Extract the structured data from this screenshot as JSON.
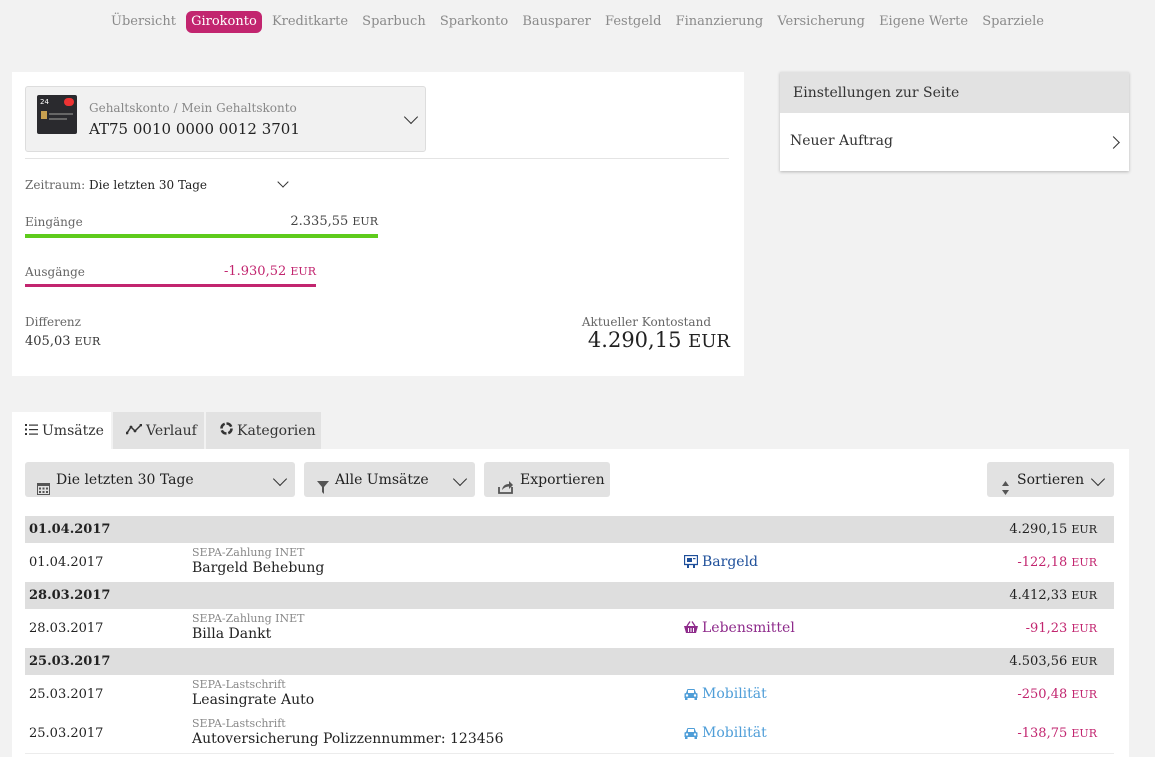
{
  "colors": {
    "accent": "#c2256f",
    "income": "#5ecb1c",
    "expense": "#c2256f",
    "cash": "#1e4f9a",
    "groceries": "#8e2b8b",
    "mobility": "#4f9ed8"
  },
  "nav": {
    "items": [
      "Übersicht",
      "Girokonto",
      "Kreditkarte",
      "Sparbuch",
      "Sparkonto",
      "Bausparer",
      "Festgeld",
      "Finanzierung",
      "Versicherung",
      "Eigene Werte",
      "Sparziele"
    ],
    "active_index": 1
  },
  "account": {
    "name": "Gehaltskonto / Mein Gehaltskonto",
    "iban": "AT75 0010 0000 0012 3701",
    "card_brand": "24"
  },
  "period": {
    "label": "Zeitraum:",
    "value": "Die letzten 30 Tage"
  },
  "summary": {
    "income_label": "Eingänge",
    "income_value": "2.335,55",
    "expense_label": "Ausgänge",
    "expense_value": "-1.930,52",
    "currency": "EUR",
    "difference_label": "Differenz",
    "difference_value": "405,03",
    "balance_label": "Aktueller Kontostand",
    "balance_value": "4.290,15"
  },
  "settings": {
    "title": "Einstellungen zur Seite",
    "new_order": "Neuer Auftrag"
  },
  "tabs": {
    "transactions": "Umsätze",
    "history": "Verlauf",
    "categories": "Kategorien"
  },
  "toolbar": {
    "period": "Die letzten 30 Tage",
    "filter": "Alle Umsätze",
    "export": "Exportieren",
    "sort": "Sortieren"
  },
  "groups": [
    {
      "date": "01.04.2017",
      "balance": "4.290,15"
    },
    {
      "date": "28.03.2017",
      "balance": "4.412,33"
    },
    {
      "date": "25.03.2017",
      "balance": "4.503,56"
    }
  ],
  "transactions": [
    {
      "date": "01.04.2017",
      "type": "SEPA-Zahlung INET",
      "description": "Bargeld Behebung",
      "category": "Bargeld",
      "category_icon": "cash-icon",
      "amount": "-122,18"
    },
    {
      "date": "28.03.2017",
      "type": "SEPA-Zahlung INET",
      "description": "Billa Dankt",
      "category": "Lebensmittel",
      "category_icon": "basket-icon",
      "amount": "-91,23"
    },
    {
      "date": "25.03.2017",
      "type": "SEPA-Lastschrift",
      "description": "Leasingrate Auto",
      "category": "Mobilität",
      "category_icon": "car-icon",
      "amount": "-250,48"
    },
    {
      "date": "25.03.2017",
      "type": "SEPA-Lastschrift",
      "description": "Autoversicherung Polizzennummer: 123456",
      "category": "Mobilität",
      "category_icon": "car-icon",
      "amount": "-138,75"
    }
  ]
}
